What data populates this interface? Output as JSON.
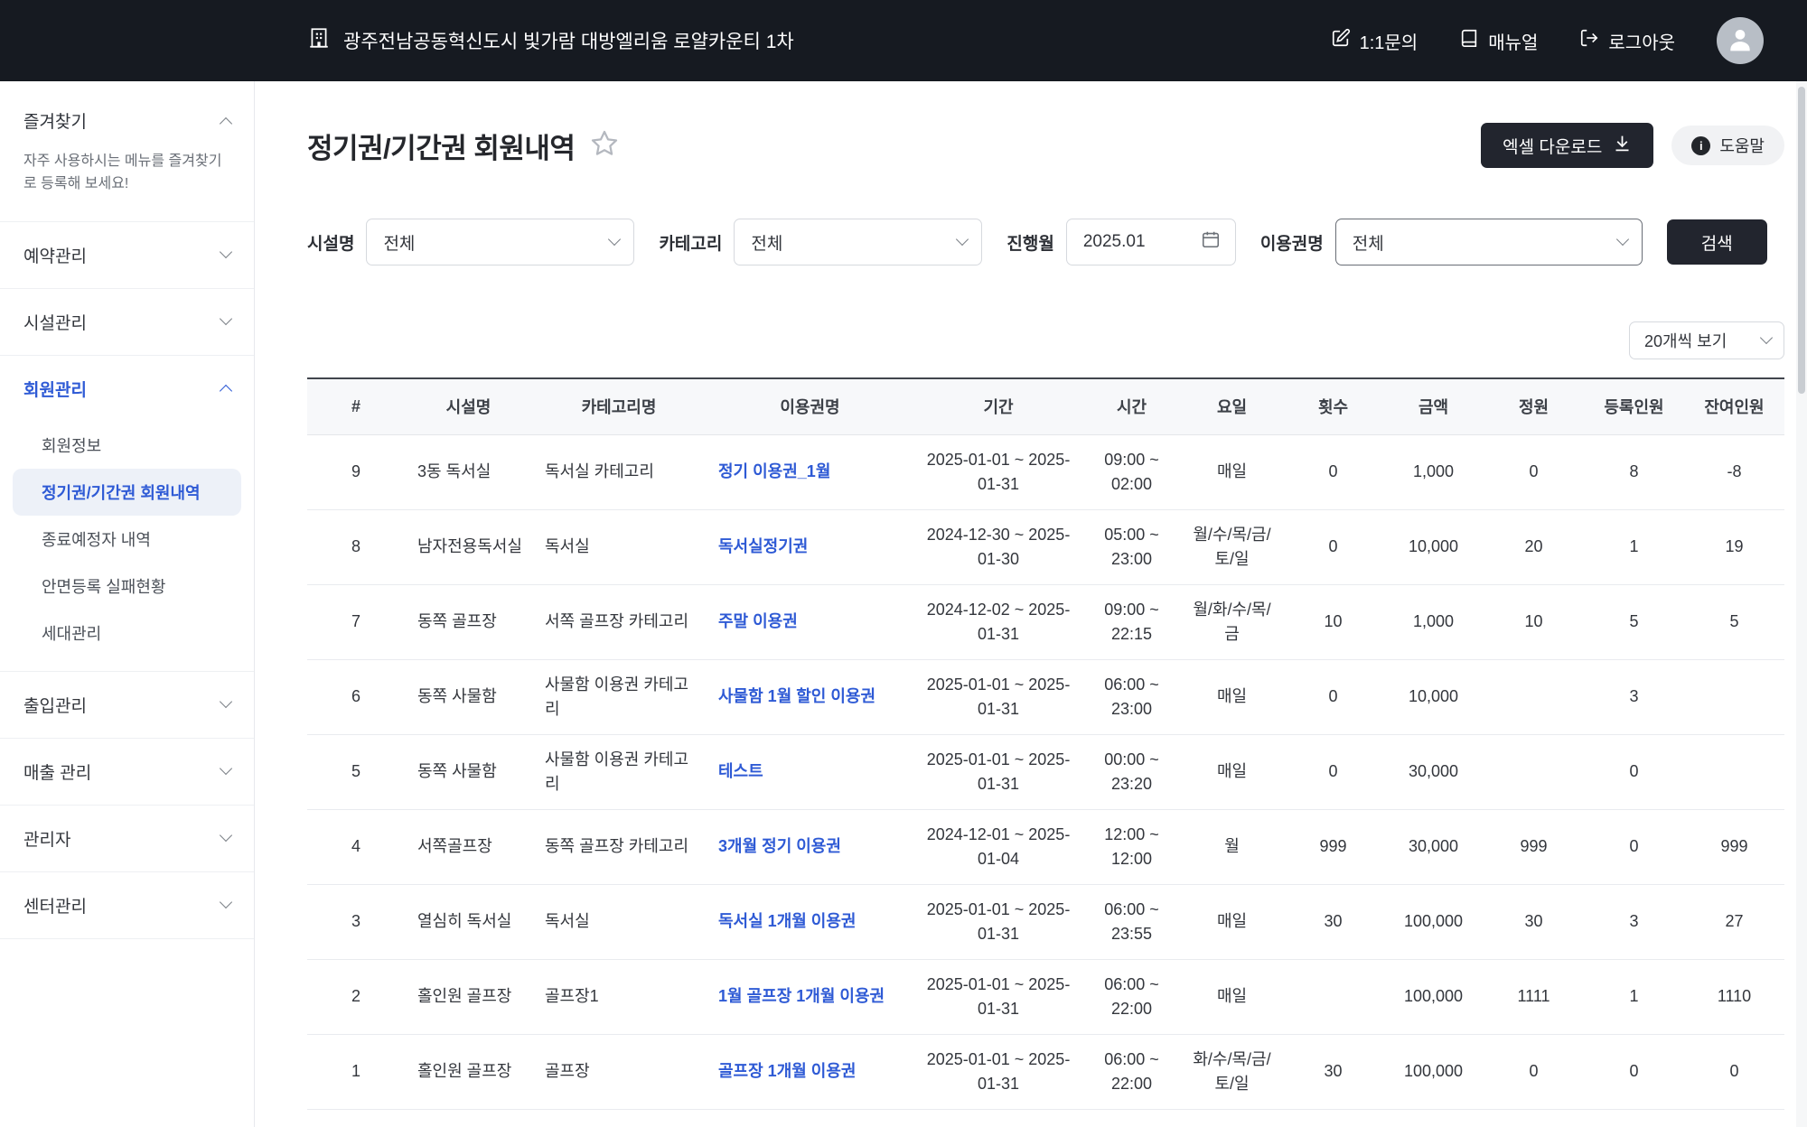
{
  "colors": {
    "accent_blue": "#2e5ad5",
    "topbar_bg": "#161a21",
    "dark_button": "#22252e"
  },
  "topbar": {
    "site_name": "광주전남공동혁신도시 빛가람 대방엘리움 로얄카운티 1차",
    "inquiry": "1:1문의",
    "manual": "매뉴얼",
    "logout": "로그아웃"
  },
  "sidebar": {
    "favorites_title": "즐겨찾기",
    "favorites_hint": "자주 사용하시는 메뉴를 즐겨찾기로 등록해 보세요!",
    "menus": [
      {
        "id": "reservation-management",
        "label": "예약관리",
        "expanded": false
      },
      {
        "id": "facility-management",
        "label": "시설관리",
        "expanded": false
      },
      {
        "id": "member-management",
        "label": "회원관리",
        "expanded": true,
        "active_child": 1,
        "children": [
          {
            "id": "member-info",
            "label": "회원정보"
          },
          {
            "id": "membership-history",
            "label": "정기권/기간권 회원내역"
          },
          {
            "id": "expiring-members",
            "label": "종료예정자 내역"
          },
          {
            "id": "face-registration-failures",
            "label": "안면등록 실패현황"
          },
          {
            "id": "household-management",
            "label": "세대관리"
          }
        ]
      },
      {
        "id": "access-management",
        "label": "출입관리",
        "expanded": false
      },
      {
        "id": "sales-management",
        "label": "매출 관리",
        "expanded": false
      },
      {
        "id": "administrator",
        "label": "관리자",
        "expanded": false
      },
      {
        "id": "center-management",
        "label": "센터관리",
        "expanded": false
      }
    ]
  },
  "page": {
    "title": "정기권/기간권 회원내역",
    "excel_button": "엑셀 다운로드",
    "help_button": "도움말"
  },
  "filters": {
    "facility": {
      "label": "시설명",
      "value": "전체"
    },
    "category": {
      "label": "카테고리",
      "value": "전체"
    },
    "month": {
      "label": "진행월",
      "value": "2025.01"
    },
    "ticket": {
      "label": "이용권명",
      "value": "전체"
    },
    "search_button": "검색",
    "page_size": "20개씩 보기"
  },
  "icons": {
    "topbar": [
      "building-icon",
      "inquiry-edit-icon",
      "manual-book-icon",
      "logout-icon",
      "avatar-person-icon"
    ],
    "page": [
      "star-icon",
      "download-icon",
      "info-icon",
      "calendar-icon",
      "chevron-down-icon",
      "chevron-up-icon"
    ]
  },
  "table": {
    "headers": [
      "#",
      "시설명",
      "카테고리명",
      "이용권명",
      "기간",
      "시간",
      "요일",
      "횟수",
      "금액",
      "정원",
      "등록인원",
      "잔여인원"
    ],
    "rows": [
      {
        "num": "9",
        "facility": "3동 독서실",
        "category": "독서실 카테고리",
        "ticket": "정기 이용권_1월",
        "period": "2025-01-01 ~ 2025-01-31",
        "time": "09:00 ~ 02:00",
        "days": "매일",
        "count": "0",
        "amount": "1,000",
        "capacity": "0",
        "registered": "8",
        "remaining": "-8"
      },
      {
        "num": "8",
        "facility": "남자전용독서실",
        "category": "독서실",
        "ticket": "독서실정기권",
        "period": "2024-12-30 ~ 2025-01-30",
        "time": "05:00 ~ 23:00",
        "days": "월/수/목/금/토/일",
        "count": "0",
        "amount": "10,000",
        "capacity": "20",
        "registered": "1",
        "remaining": "19"
      },
      {
        "num": "7",
        "facility": "동쪽 골프장",
        "category": "서쪽 골프장 카테고리",
        "ticket": "주말 이용권",
        "period": "2024-12-02 ~ 2025-01-31",
        "time": "09:00 ~ 22:15",
        "days": "월/화/수/목/금",
        "count": "10",
        "amount": "1,000",
        "capacity": "10",
        "registered": "5",
        "remaining": "5"
      },
      {
        "num": "6",
        "facility": "동쪽 사물함",
        "category": "사물함 이용권 카테고리",
        "ticket": "사물함 1월 할인 이용권",
        "period": "2025-01-01 ~ 2025-01-31",
        "time": "06:00 ~ 23:00",
        "days": "매일",
        "count": "0",
        "amount": "10,000",
        "capacity": "",
        "registered": "3",
        "remaining": ""
      },
      {
        "num": "5",
        "facility": "동쪽 사물함",
        "category": "사물함 이용권 카테고리",
        "ticket": "테스트",
        "period": "2025-01-01 ~ 2025-01-31",
        "time": "00:00 ~ 23:20",
        "days": "매일",
        "count": "0",
        "amount": "30,000",
        "capacity": "",
        "registered": "0",
        "remaining": ""
      },
      {
        "num": "4",
        "facility": "서쪽골프장",
        "category": "동쪽 골프장 카테고리",
        "ticket": "3개월 정기 이용권",
        "period": "2024-12-01 ~ 2025-01-04",
        "time": "12:00 ~ 12:00",
        "days": "월",
        "count": "999",
        "amount": "30,000",
        "capacity": "999",
        "registered": "0",
        "remaining": "999"
      },
      {
        "num": "3",
        "facility": "열심히 독서실",
        "category": "독서실",
        "ticket": "독서실 1개월 이용권",
        "period": "2025-01-01 ~ 2025-01-31",
        "time": "06:00 ~ 23:55",
        "days": "매일",
        "count": "30",
        "amount": "100,000",
        "capacity": "30",
        "registered": "3",
        "remaining": "27"
      },
      {
        "num": "2",
        "facility": "홀인원 골프장",
        "category": "골프장1",
        "ticket": "1월 골프장 1개월 이용권",
        "period": "2025-01-01 ~ 2025-01-31",
        "time": "06:00 ~ 22:00",
        "days": "매일",
        "count": "",
        "amount": "100,000",
        "capacity": "1111",
        "registered": "1",
        "remaining": "1110"
      },
      {
        "num": "1",
        "facility": "홀인원 골프장",
        "category": "골프장",
        "ticket": "골프장 1개월 이용권",
        "period": "2025-01-01 ~ 2025-01-31",
        "time": "06:00 ~ 22:00",
        "days": "화/수/목/금/토/일",
        "count": "30",
        "amount": "100,000",
        "capacity": "0",
        "registered": "0",
        "remaining": "0"
      }
    ]
  }
}
